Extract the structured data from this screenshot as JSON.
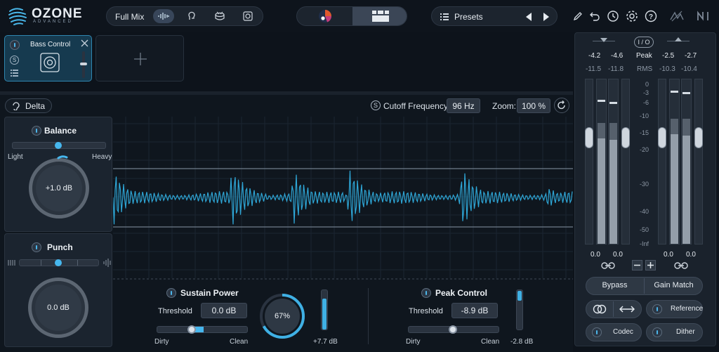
{
  "app": {
    "logo_title": "OZONE",
    "logo_subtitle": "ADVANCED"
  },
  "modebar": {
    "label": "Full Mix",
    "modes": [
      "waveform-icon",
      "vocal-icon",
      "drum-icon",
      "instrument-icon"
    ],
    "active_mode": "waveform-icon"
  },
  "presets": {
    "label": "Presets"
  },
  "module": {
    "name": "Bass Control"
  },
  "toolbar": {
    "delta_label": "Delta",
    "cutoff_label": "Cutoff Frequency:",
    "cutoff_value": "96 Hz",
    "zoom_label": "Zoom:",
    "zoom_value": "100 %"
  },
  "balance": {
    "title": "Balance",
    "left_label": "Light",
    "right_label": "Heavy",
    "value": "+1.0 dB"
  },
  "punch": {
    "title": "Punch",
    "value": "0.0 dB"
  },
  "sustain": {
    "title": "Sustain Power",
    "threshold_label": "Threshold",
    "threshold_value": "0.0 dB",
    "left_label": "Dirty",
    "right_label": "Clean",
    "amount": "67%",
    "amount_fraction": 0.67,
    "gain": "+7.7 dB"
  },
  "peak": {
    "title": "Peak Control",
    "threshold_label": "Threshold",
    "threshold_value": "-8.9 dB",
    "left_label": "Dirty",
    "right_label": "Clean",
    "gain": "-2.8 dB"
  },
  "meters": {
    "io_label": "I / O",
    "peak_label": "Peak",
    "rms_label": "RMS",
    "input_peak": [
      "-4.2",
      "-4.6"
    ],
    "input_rms": [
      "-11.5",
      "-11.8"
    ],
    "output_peak": [
      "-2.5",
      "-2.7"
    ],
    "output_rms": [
      "-10.3",
      "-10.4"
    ],
    "scale": [
      "0",
      "-3",
      "-6",
      "-10",
      "-15",
      "-20",
      "-30",
      "-40",
      "-50",
      "-Inf"
    ],
    "input_gain": [
      "0.0",
      "0.0"
    ],
    "output_gain": [
      "0.0",
      "0.0"
    ]
  },
  "buttons": {
    "bypass": "Bypass",
    "gain_match": "Gain Match",
    "reference": "Reference",
    "codec": "Codec",
    "dither": "Dither"
  },
  "colors": {
    "accent": "#3fb0e4",
    "waveform": "#2ea6d6",
    "module_active": "#163a4f"
  }
}
